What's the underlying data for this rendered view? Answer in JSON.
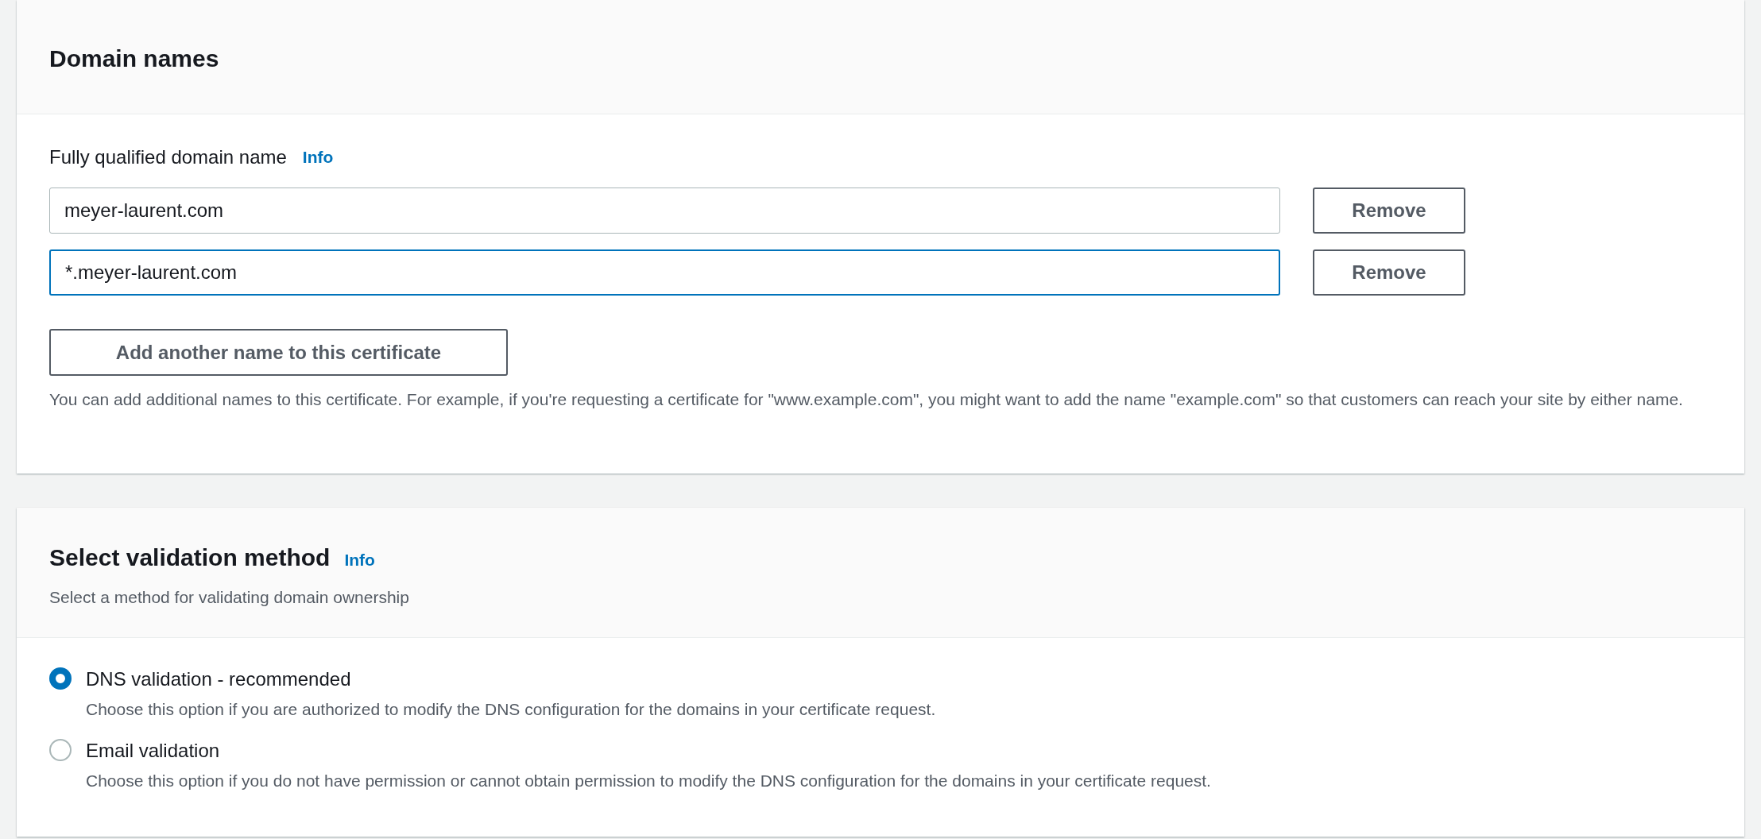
{
  "domain_names": {
    "title": "Domain names",
    "field_label": "Fully qualified domain name",
    "info_link": "Info",
    "fields": [
      {
        "value": "meyer-laurent.com",
        "focused": false,
        "remove_button": "Remove"
      },
      {
        "value": "*.meyer-laurent.com",
        "focused": true,
        "remove_button": "Remove"
      }
    ],
    "add_button": "Add another name to this certificate",
    "help_text": "You can add additional names to this certificate. For example, if you're requesting a certificate for \"www.example.com\", you might want to add the name \"example.com\" so that customers can reach your site by either name."
  },
  "validation": {
    "title": "Select validation method",
    "info_link": "Info",
    "subtitle": "Select a method for validating domain ownership",
    "options": [
      {
        "label": "DNS validation - recommended",
        "description": "Choose this option if you are authorized to modify the DNS configuration for the domains in your certificate request.",
        "selected": true
      },
      {
        "label": "Email validation",
        "description": "Choose this option if you do not have permission or cannot obtain permission to modify the DNS configuration for the domains in your certificate request.",
        "selected": false
      }
    ]
  }
}
